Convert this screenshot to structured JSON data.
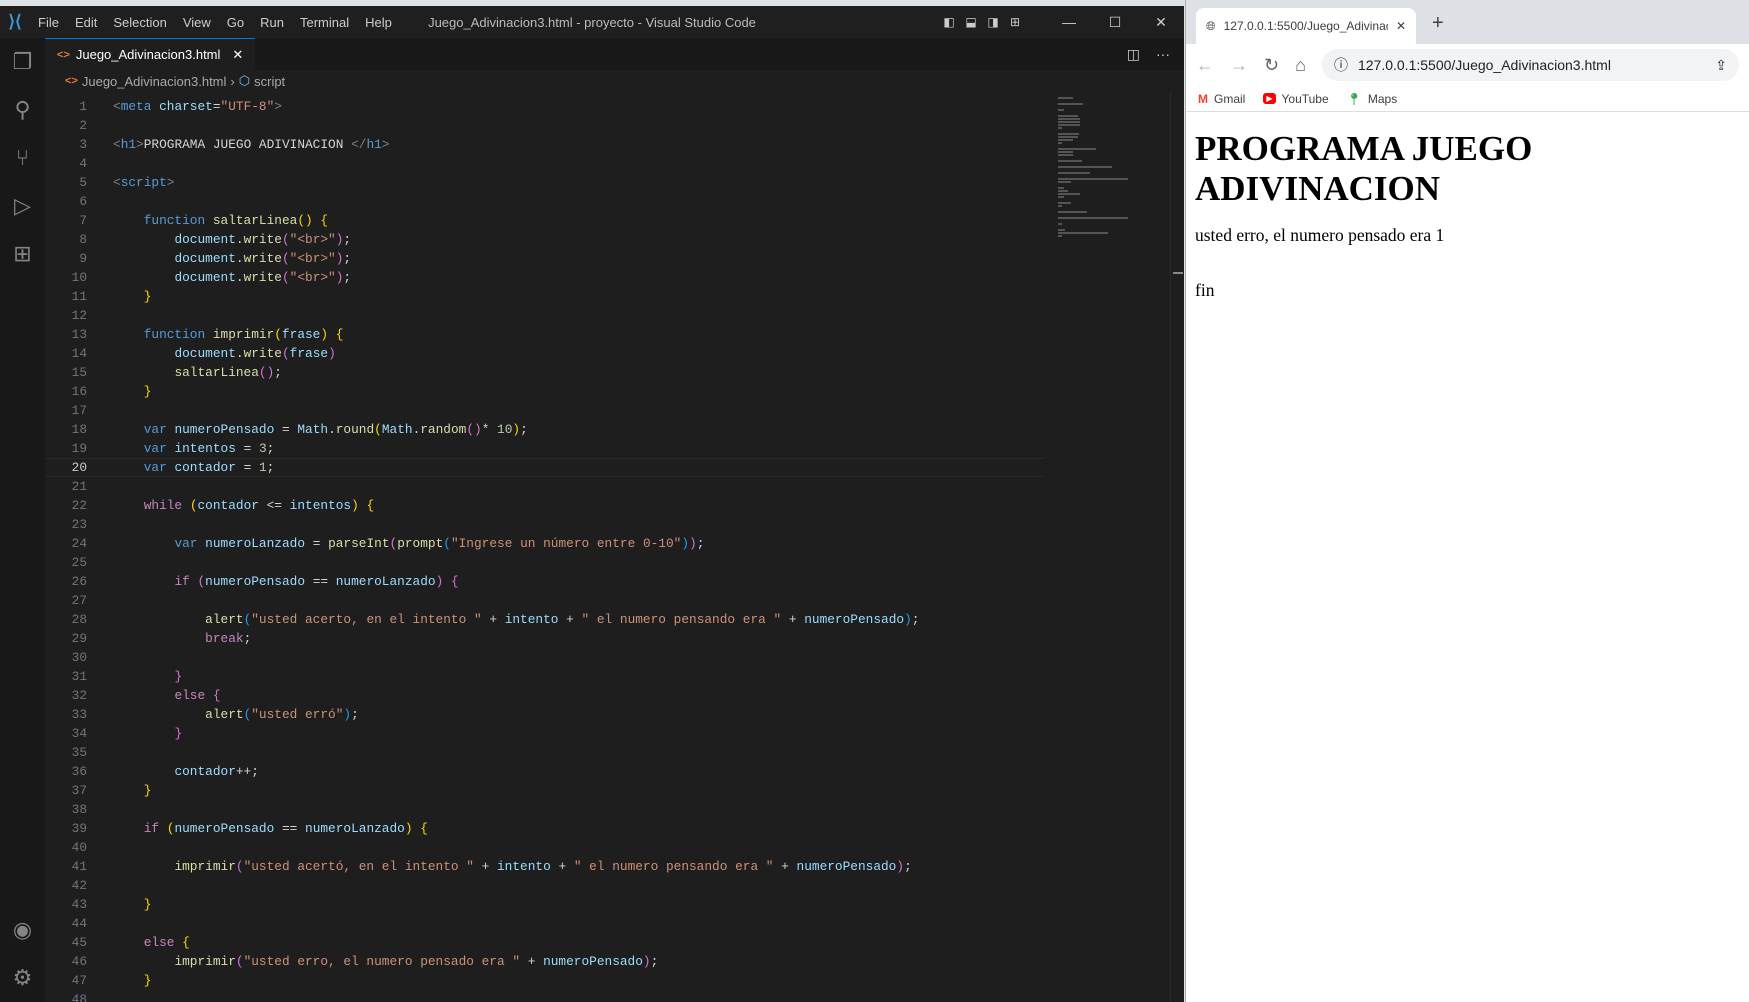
{
  "vscode": {
    "menu": [
      "File",
      "Edit",
      "Selection",
      "View",
      "Go",
      "Run",
      "Terminal",
      "Help"
    ],
    "window_title": "Juego_Adivinacion3.html - proyecto - Visual Studio Code",
    "tab_label": "Juego_Adivinacion3.html",
    "breadcrumb": {
      "file": "Juego_Adivinacion3.html",
      "symbol": "script"
    },
    "current_line": 20,
    "code": [
      [
        [
          "punc",
          "<"
        ],
        [
          "kw",
          "meta"
        ],
        [
          "var",
          " charset"
        ],
        [
          "txt0",
          "="
        ],
        [
          "str",
          "\"UTF-8\""
        ],
        [
          "punc",
          ">"
        ]
      ],
      [],
      [
        [
          "punc",
          "<"
        ],
        [
          "kw",
          "h1"
        ],
        [
          "punc",
          ">"
        ],
        [
          "txt0",
          "PROGRAMA JUEGO ADIVINACION "
        ],
        [
          "punc",
          "</"
        ],
        [
          "kw",
          "h1"
        ],
        [
          "punc",
          ">"
        ]
      ],
      [],
      [
        [
          "punc",
          "<"
        ],
        [
          "kw",
          "script"
        ],
        [
          "punc",
          ">"
        ]
      ],
      [],
      [
        [
          "txt0",
          "    "
        ],
        [
          "kw",
          "function"
        ],
        [
          "txt0",
          " "
        ],
        [
          "fn",
          "saltarLinea"
        ],
        [
          "b1",
          "()"
        ],
        [
          "txt0",
          " "
        ],
        [
          "b1",
          "{"
        ]
      ],
      [
        [
          "txt0",
          "        "
        ],
        [
          "var",
          "document"
        ],
        [
          "txt0",
          "."
        ],
        [
          "fn",
          "write"
        ],
        [
          "b2",
          "("
        ],
        [
          "str",
          "\"<br>\""
        ],
        [
          "b2",
          ")"
        ],
        [
          "txt0",
          ";"
        ]
      ],
      [
        [
          "txt0",
          "        "
        ],
        [
          "var",
          "document"
        ],
        [
          "txt0",
          "."
        ],
        [
          "fn",
          "write"
        ],
        [
          "b2",
          "("
        ],
        [
          "str",
          "\"<br>\""
        ],
        [
          "b2",
          ")"
        ],
        [
          "txt0",
          ";"
        ]
      ],
      [
        [
          "txt0",
          "        "
        ],
        [
          "var",
          "document"
        ],
        [
          "txt0",
          "."
        ],
        [
          "fn",
          "write"
        ],
        [
          "b2",
          "("
        ],
        [
          "str",
          "\"<br>\""
        ],
        [
          "b2",
          ")"
        ],
        [
          "txt0",
          ";"
        ]
      ],
      [
        [
          "txt0",
          "    "
        ],
        [
          "b1",
          "}"
        ]
      ],
      [],
      [
        [
          "txt0",
          "    "
        ],
        [
          "kw",
          "function"
        ],
        [
          "txt0",
          " "
        ],
        [
          "fn",
          "imprimir"
        ],
        [
          "b1",
          "("
        ],
        [
          "var",
          "frase"
        ],
        [
          "b1",
          ")"
        ],
        [
          "txt0",
          " "
        ],
        [
          "b1",
          "{"
        ]
      ],
      [
        [
          "txt0",
          "        "
        ],
        [
          "var",
          "document"
        ],
        [
          "txt0",
          "."
        ],
        [
          "fn",
          "write"
        ],
        [
          "b2",
          "("
        ],
        [
          "var",
          "frase"
        ],
        [
          "b2",
          ")"
        ]
      ],
      [
        [
          "txt0",
          "        "
        ],
        [
          "fn",
          "saltarLinea"
        ],
        [
          "b2",
          "()"
        ],
        [
          "txt0",
          ";"
        ]
      ],
      [
        [
          "txt0",
          "    "
        ],
        [
          "b1",
          "}"
        ]
      ],
      [],
      [
        [
          "txt0",
          "    "
        ],
        [
          "kw",
          "var"
        ],
        [
          "txt0",
          " "
        ],
        [
          "var",
          "numeroPensado"
        ],
        [
          "txt0",
          " = "
        ],
        [
          "var",
          "Math"
        ],
        [
          "txt0",
          "."
        ],
        [
          "fn",
          "round"
        ],
        [
          "b1",
          "("
        ],
        [
          "var",
          "Math"
        ],
        [
          "txt0",
          "."
        ],
        [
          "fn",
          "random"
        ],
        [
          "b2",
          "()"
        ],
        [
          "txt0",
          "* "
        ],
        [
          "num2",
          "10"
        ],
        [
          "b1",
          ")"
        ],
        [
          "txt0",
          ";"
        ]
      ],
      [
        [
          "txt0",
          "    "
        ],
        [
          "kw",
          "var"
        ],
        [
          "txt0",
          " "
        ],
        [
          "var",
          "intentos"
        ],
        [
          "txt0",
          " = "
        ],
        [
          "num2",
          "3"
        ],
        [
          "txt0",
          ";"
        ]
      ],
      [
        [
          "txt0",
          "    "
        ],
        [
          "kw",
          "var"
        ],
        [
          "txt0",
          " "
        ],
        [
          "var",
          "contador"
        ],
        [
          "txt0",
          " = "
        ],
        [
          "num2",
          "1"
        ],
        [
          "txt0",
          ";"
        ]
      ],
      [],
      [
        [
          "txt0",
          "    "
        ],
        [
          "ctl",
          "while"
        ],
        [
          "txt0",
          " "
        ],
        [
          "b1",
          "("
        ],
        [
          "var",
          "contador"
        ],
        [
          "txt0",
          " <= "
        ],
        [
          "var",
          "intentos"
        ],
        [
          "b1",
          ")"
        ],
        [
          "txt0",
          " "
        ],
        [
          "b1",
          "{"
        ]
      ],
      [],
      [
        [
          "txt0",
          "        "
        ],
        [
          "kw",
          "var"
        ],
        [
          "txt0",
          " "
        ],
        [
          "var",
          "numeroLanzado"
        ],
        [
          "txt0",
          " = "
        ],
        [
          "fn",
          "parseInt"
        ],
        [
          "b2",
          "("
        ],
        [
          "fn",
          "prompt"
        ],
        [
          "b3",
          "("
        ],
        [
          "str",
          "\"Ingrese un número entre 0-10\""
        ],
        [
          "b3",
          ")"
        ],
        [
          "b2",
          ")"
        ],
        [
          "txt0",
          ";"
        ]
      ],
      [],
      [
        [
          "txt0",
          "        "
        ],
        [
          "ctl",
          "if"
        ],
        [
          "txt0",
          " "
        ],
        [
          "b2",
          "("
        ],
        [
          "var",
          "numeroPensado"
        ],
        [
          "txt0",
          " == "
        ],
        [
          "var",
          "numeroLanzado"
        ],
        [
          "b2",
          ")"
        ],
        [
          "txt0",
          " "
        ],
        [
          "b2",
          "{"
        ]
      ],
      [],
      [
        [
          "txt0",
          "            "
        ],
        [
          "fn",
          "alert"
        ],
        [
          "b3",
          "("
        ],
        [
          "str",
          "\"usted acerto, en el intento \""
        ],
        [
          "txt0",
          " + "
        ],
        [
          "var",
          "intento"
        ],
        [
          "txt0",
          " + "
        ],
        [
          "str",
          "\" el numero pensando era \""
        ],
        [
          "txt0",
          " + "
        ],
        [
          "var",
          "numeroPensado"
        ],
        [
          "b3",
          ")"
        ],
        [
          "txt0",
          ";"
        ]
      ],
      [
        [
          "txt0",
          "            "
        ],
        [
          "ctl",
          "break"
        ],
        [
          "txt0",
          ";"
        ]
      ],
      [],
      [
        [
          "txt0",
          "        "
        ],
        [
          "b2",
          "}"
        ]
      ],
      [
        [
          "txt0",
          "        "
        ],
        [
          "ctl",
          "else"
        ],
        [
          "txt0",
          " "
        ],
        [
          "b2",
          "{"
        ]
      ],
      [
        [
          "txt0",
          "            "
        ],
        [
          "fn",
          "alert"
        ],
        [
          "b3",
          "("
        ],
        [
          "str",
          "\"usted erró\""
        ],
        [
          "b3",
          ")"
        ],
        [
          "txt0",
          ";"
        ]
      ],
      [
        [
          "txt0",
          "        "
        ],
        [
          "b2",
          "}"
        ]
      ],
      [],
      [
        [
          "txt0",
          "        "
        ],
        [
          "var",
          "contador"
        ],
        [
          "txt0",
          "++;"
        ]
      ],
      [
        [
          "txt0",
          "    "
        ],
        [
          "b1",
          "}"
        ]
      ],
      [],
      [
        [
          "txt0",
          "    "
        ],
        [
          "ctl",
          "if"
        ],
        [
          "txt0",
          " "
        ],
        [
          "b1",
          "("
        ],
        [
          "var",
          "numeroPensado"
        ],
        [
          "txt0",
          " == "
        ],
        [
          "var",
          "numeroLanzado"
        ],
        [
          "b1",
          ")"
        ],
        [
          "txt0",
          " "
        ],
        [
          "b1",
          "{"
        ]
      ],
      [],
      [
        [
          "txt0",
          "        "
        ],
        [
          "fn",
          "imprimir"
        ],
        [
          "b2",
          "("
        ],
        [
          "str",
          "\"usted acertó, en el intento \""
        ],
        [
          "txt0",
          " + "
        ],
        [
          "var",
          "intento"
        ],
        [
          "txt0",
          " + "
        ],
        [
          "str",
          "\" el numero pensando era \""
        ],
        [
          "txt0",
          " + "
        ],
        [
          "var",
          "numeroPensado"
        ],
        [
          "b2",
          ")"
        ],
        [
          "txt0",
          ";"
        ]
      ],
      [],
      [
        [
          "txt0",
          "    "
        ],
        [
          "b1",
          "}"
        ]
      ],
      [],
      [
        [
          "txt0",
          "    "
        ],
        [
          "ctl",
          "else"
        ],
        [
          "txt0",
          " "
        ],
        [
          "b1",
          "{"
        ]
      ],
      [
        [
          "txt0",
          "        "
        ],
        [
          "fn",
          "imprimir"
        ],
        [
          "b2",
          "("
        ],
        [
          "str",
          "\"usted erro, el numero pensado era \""
        ],
        [
          "txt0",
          " + "
        ],
        [
          "var",
          "numeroPensado"
        ],
        [
          "b2",
          ")"
        ],
        [
          "txt0",
          ";"
        ]
      ],
      [
        [
          "txt0",
          "    "
        ],
        [
          "b1",
          "}"
        ]
      ],
      []
    ]
  },
  "browser": {
    "tab_title": "127.0.0.1:5500/Juego_Adivinacion3.html",
    "url": "127.0.0.1:5500/Juego_Adivinacion3.html",
    "bookmarks": [
      {
        "label": "Gmail",
        "icon": "gmail-icon"
      },
      {
        "label": "YouTube",
        "icon": "youtube-icon"
      },
      {
        "label": "Maps",
        "icon": "maps-icon"
      }
    ],
    "page": {
      "heading": "PROGRAMA JUEGO ADIVINACION",
      "lines": [
        "usted erro, el numero pensado era 1",
        "fin"
      ]
    }
  }
}
